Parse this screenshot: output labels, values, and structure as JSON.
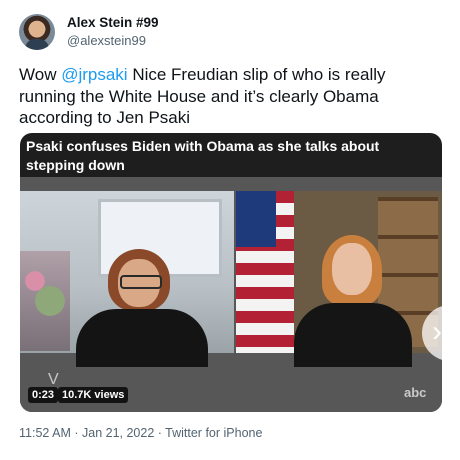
{
  "user": {
    "name": "Alex Stein #99",
    "handle": "@alexstein99"
  },
  "tweet": {
    "prefix": "Wow ",
    "mention": "@jrpsaki",
    "body": " Nice Freudian slip of who is really running the White House and it’s clearly Obama according to Jen Psaki"
  },
  "media": {
    "caption": "Psaki confuses Biden with Obama as she talks about stepping down",
    "duration": "0:23",
    "views": "10.7K views",
    "watermark_left": "V",
    "watermark_right": "abc",
    "next_icon": "chevron-right-icon",
    "next_glyph": "›"
  },
  "meta": {
    "line": "11:52 AM · Jan 21, 2022 · Twitter for iPhone"
  },
  "colors": {
    "link": "#1d9bf0",
    "secondary_text": "#536471"
  }
}
